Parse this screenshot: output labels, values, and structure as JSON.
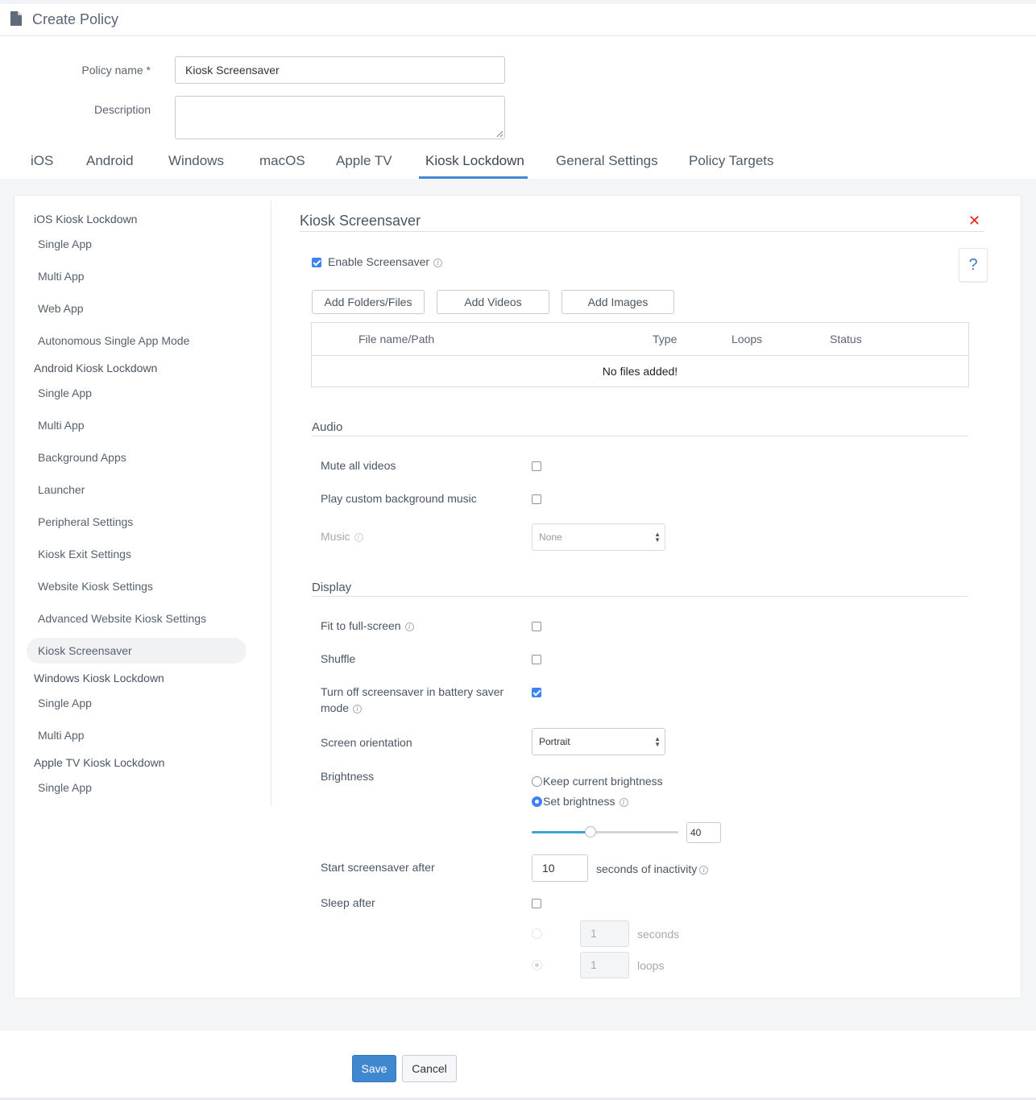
{
  "header": {
    "title": "Create Policy",
    "icon": "document-icon"
  },
  "form": {
    "policy_name_label": "Policy name *",
    "policy_name_value": "Kiosk Screensaver",
    "description_label": "Description",
    "description_value": ""
  },
  "tabs": [
    {
      "label": "iOS"
    },
    {
      "label": "Android"
    },
    {
      "label": "Windows"
    },
    {
      "label": "macOS"
    },
    {
      "label": "Apple TV"
    },
    {
      "label": "Kiosk Lockdown",
      "active": true
    },
    {
      "label": "General Settings"
    },
    {
      "label": "Policy Targets"
    }
  ],
  "sidebar": {
    "groups": [
      {
        "title": "iOS Kiosk Lockdown",
        "items": [
          "Single App",
          "Multi App",
          "Web App",
          "Autonomous Single App Mode"
        ]
      },
      {
        "title": "Android Kiosk Lockdown",
        "items": [
          "Single App",
          "Multi App",
          "Background Apps",
          "Launcher",
          "Peripheral Settings",
          "Kiosk Exit Settings",
          "Website Kiosk Settings",
          "Advanced Website Kiosk Settings",
          "Kiosk Screensaver"
        ]
      },
      {
        "title": "Windows Kiosk Lockdown",
        "items": [
          "Single App",
          "Multi App"
        ]
      },
      {
        "title": "Apple TV Kiosk Lockdown",
        "items": [
          "Single App"
        ]
      }
    ],
    "active_item": "Kiosk Screensaver"
  },
  "main": {
    "title": "Kiosk Screensaver",
    "close_symbol": "✕",
    "help_symbol": "?",
    "enable_label": "Enable Screensaver",
    "enable_checked": true,
    "buttons": {
      "add_folders": "Add Folders/Files",
      "add_videos": "Add Videos",
      "add_images": "Add Images"
    },
    "table": {
      "columns": [
        "File name/Path",
        "Type",
        "Loops",
        "Status"
      ],
      "empty_text": "No files added!"
    },
    "audio": {
      "title": "Audio",
      "mute_label": "Mute all videos",
      "mute_checked": false,
      "custom_music_label": "Play custom background music",
      "custom_music_checked": false,
      "music_label": "Music",
      "music_value": "None"
    },
    "display": {
      "title": "Display",
      "fit_label": "Fit to full-screen",
      "fit_checked": false,
      "shuffle_label": "Shuffle",
      "shuffle_checked": false,
      "battery_label_line1": "Turn off screensaver in battery saver",
      "battery_label_line2": "mode",
      "battery_checked": true,
      "orientation_label": "Screen orientation",
      "orientation_value": "Portrait",
      "brightness_label": "Brightness",
      "brightness_option_keep": "Keep current brightness",
      "brightness_option_set": "Set brightness",
      "brightness_selected": "set",
      "brightness_value": "40",
      "brightness_fraction": 0.4,
      "start_label": "Start screensaver after",
      "start_value": "10",
      "start_suffix": "seconds of inactivity",
      "sleep_label": "Sleep after",
      "sleep_checked": false,
      "sleep_seconds_value": "1",
      "sleep_seconds_suffix": "seconds",
      "sleep_loops_value": "1",
      "sleep_loops_suffix": "loops"
    }
  },
  "footer": {
    "save_label": "Save",
    "cancel_label": "Cancel"
  },
  "colors": {
    "accent": "#3e8ad6",
    "primary_button": "#3f87cf",
    "close": "#e02424",
    "checkbox": "#3b82f6"
  }
}
